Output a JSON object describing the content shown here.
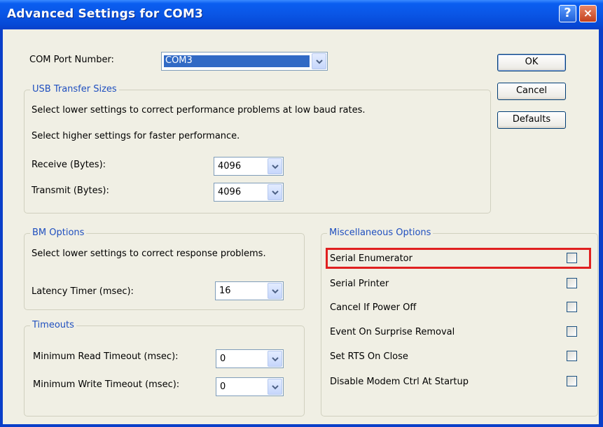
{
  "window": {
    "title": "Advanced Settings for COM3",
    "help_label": "?",
    "close_label": "×"
  },
  "com_port": {
    "label": "COM Port Number:",
    "value": "COM3"
  },
  "buttons": {
    "ok": "OK",
    "cancel": "Cancel",
    "defaults": "Defaults"
  },
  "usb": {
    "title": "USB Transfer Sizes",
    "line1": "Select lower settings to correct performance problems at low baud rates.",
    "line2": "Select higher settings for faster performance.",
    "receive_label": "Receive (Bytes):",
    "receive_value": "4096",
    "transmit_label": "Transmit (Bytes):",
    "transmit_value": "4096"
  },
  "bm": {
    "title": "BM Options",
    "line1": "Select lower settings to correct response problems.",
    "latency_label": "Latency Timer (msec):",
    "latency_value": "16"
  },
  "timeouts": {
    "title": "Timeouts",
    "read_label": "Minimum Read Timeout (msec):",
    "read_value": "0",
    "write_label": "Minimum Write Timeout (msec):",
    "write_value": "0"
  },
  "misc": {
    "title": "Miscellaneous Options",
    "items": [
      {
        "label": "Serial Enumerator",
        "checked": false,
        "highlighted": true
      },
      {
        "label": "Serial Printer",
        "checked": false
      },
      {
        "label": "Cancel If Power Off",
        "checked": false
      },
      {
        "label": "Event On Surprise Removal",
        "checked": false
      },
      {
        "label": "Set RTS On Close",
        "checked": false
      },
      {
        "label": "Disable Modem Ctrl At Startup",
        "checked": false
      }
    ]
  },
  "colors": {
    "titlebar": "#0a55e5",
    "dialog_bg": "#f0efe4",
    "group_title": "#1f4fbf",
    "highlight": "#e02020",
    "selection": "#316ac5"
  },
  "icons": {
    "dropdown": "chevron-down-icon",
    "help": "help-icon",
    "close": "close-icon"
  }
}
